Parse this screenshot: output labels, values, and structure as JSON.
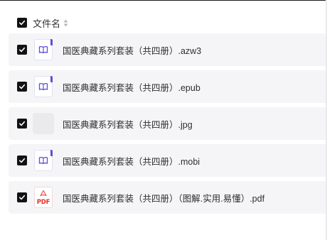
{
  "header": {
    "select_all_checked": true,
    "column_label": "文件名",
    "sort_icon": "sort-icon"
  },
  "files": [
    {
      "name": "国医典藏系列套装（共四册）.azw3",
      "type": "ebook",
      "icon": "ebook-icon",
      "checked": true
    },
    {
      "name": "国医典藏系列套装（共四册）.epub",
      "type": "ebook",
      "icon": "ebook-icon",
      "checked": true
    },
    {
      "name": "国医典藏系列套装（共四册）.jpg",
      "type": "image",
      "icon": "image-thumbnail",
      "checked": true
    },
    {
      "name": "国医典藏系列套装（共四册）.mobi",
      "type": "ebook",
      "icon": "ebook-icon",
      "checked": true
    },
    {
      "name": "国医典藏系列套装（共四册）（图解.实用.易懂）.pdf",
      "type": "pdf",
      "icon": "pdf-icon",
      "icon_text": "PDF",
      "checked": true
    }
  ],
  "colors": {
    "checkbox": "#121212",
    "row_background": "#f5f5f7",
    "ebook_accent": "#5b4fd6",
    "pdf_red": "#e0312b"
  }
}
